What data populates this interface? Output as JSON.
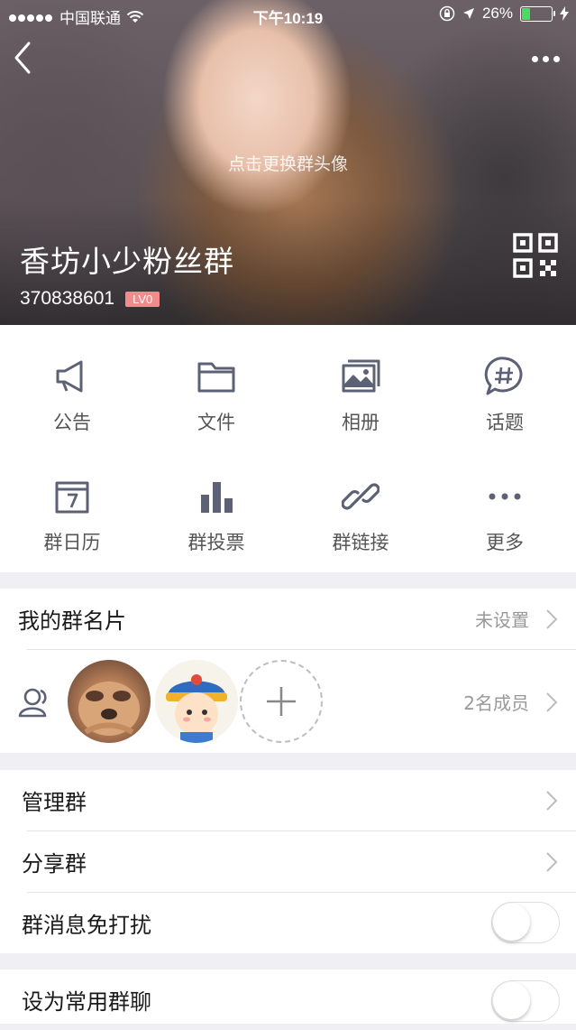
{
  "status_bar": {
    "carrier": "中国联通",
    "time": "下午10:19",
    "battery": "26%",
    "battery_level": 0.26
  },
  "header": {
    "change_avatar_hint": "点击更换群头像",
    "group_name": "香坊小少粉丝群",
    "group_id": "370838601",
    "level_badge": "LV0"
  },
  "features": [
    {
      "label": "公告",
      "icon": "megaphone-icon"
    },
    {
      "label": "文件",
      "icon": "folder-icon"
    },
    {
      "label": "相册",
      "icon": "album-icon"
    },
    {
      "label": "话题",
      "icon": "topic-icon"
    },
    {
      "label": "群日历",
      "icon": "calendar-icon"
    },
    {
      "label": "群投票",
      "icon": "vote-icon"
    },
    {
      "label": "群链接",
      "icon": "link-icon"
    },
    {
      "label": "更多",
      "icon": "more-icon"
    }
  ],
  "card": {
    "my_card_label": "我的群名片",
    "my_card_value": "未设置",
    "members_count": "2名成员"
  },
  "settings": {
    "manage": "管理群",
    "share": "分享群",
    "mute": "群消息免打扰",
    "mute_on": false,
    "favorite": "设为常用群聊",
    "favorite_on": false
  },
  "colors": {
    "icon": "#5c6175",
    "badge": "#f08c8c",
    "battery": "#4cd964"
  }
}
